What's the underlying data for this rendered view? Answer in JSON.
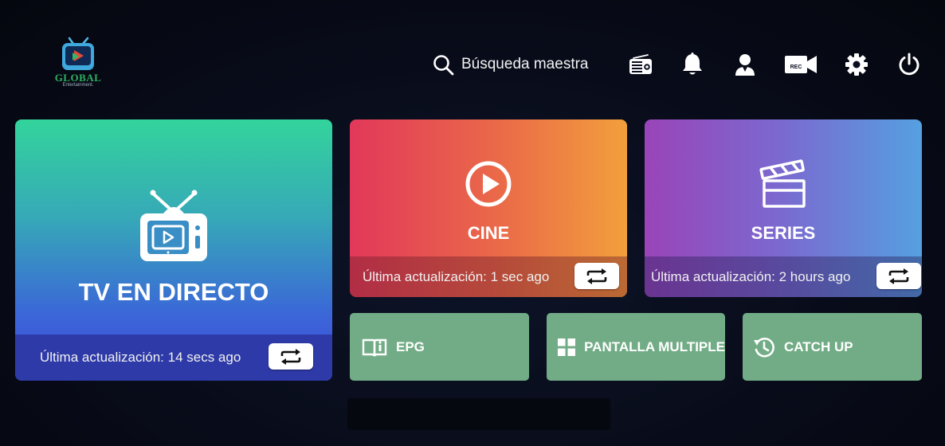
{
  "logo": {
    "brand": "GLOBAL",
    "tagline": "Entertainment."
  },
  "search": {
    "label": "Búsqueda maestra",
    "icon": "search-icon"
  },
  "toolbar": {
    "icons": [
      "radio-icon",
      "bell-icon",
      "user-icon",
      "record-camera-icon",
      "gear-icon",
      "power-icon"
    ],
    "rec_text": "REC"
  },
  "tiles": {
    "tv": {
      "title": "TV EN DIRECTO",
      "updated": "Última actualización: 14 secs ago",
      "icon": "tv-icon"
    },
    "cine": {
      "title": "CINE",
      "updated": "Última actualización: 1 sec ago",
      "icon": "play-icon"
    },
    "series": {
      "title": "SERIES",
      "updated": "Última actualización: 2 hours ago",
      "icon": "clapperboard-icon"
    }
  },
  "shortcuts": [
    {
      "label": "EPG",
      "icon": "guide-book-icon"
    },
    {
      "label": "PANTALLA MULTIPLE",
      "icon": "grid-icon"
    },
    {
      "label": "CATCH UP",
      "icon": "history-icon"
    }
  ],
  "colors": {
    "background": "#080c1a",
    "tv_gradient": [
      "#33d49c",
      "#4048d8"
    ],
    "cine_gradient": [
      "#e2385a",
      "#f29f3c"
    ],
    "series_gradient": [
      "#9a44b8",
      "#55a0e0"
    ],
    "shortcut_green": "#72ac86"
  }
}
